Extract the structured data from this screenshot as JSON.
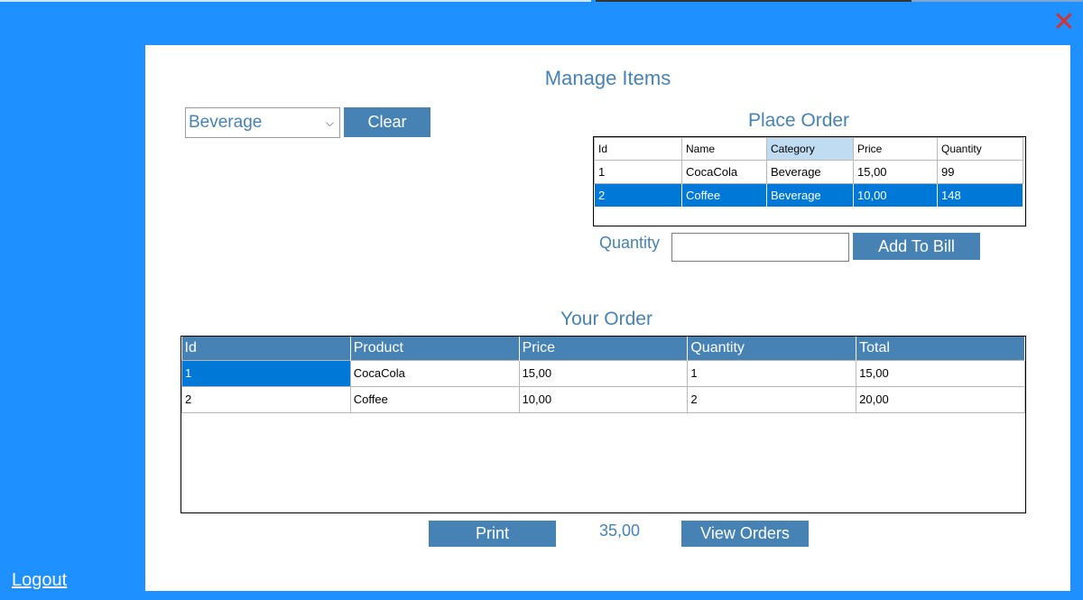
{
  "window": {
    "close_glyph": "✕",
    "logout_label": "Logout"
  },
  "manage": {
    "title": "Manage Items",
    "category_selected": "Beverage",
    "clear_label": "Clear"
  },
  "place_order": {
    "title": "Place Order",
    "columns": [
      "Id",
      "Name",
      "Category",
      "Price",
      "Quantity"
    ],
    "rows": [
      [
        "1",
        "CocaCola",
        "Beverage",
        "15,00",
        "99"
      ],
      [
        "2",
        "Coffee",
        "Beverage",
        "10,00",
        "148"
      ]
    ],
    "quantity_label": "Quantity",
    "quantity_value": "",
    "add_label": "Add To Bill"
  },
  "your_order": {
    "title": "Your Order",
    "columns": [
      "Id",
      "Product",
      "Price",
      "Quantity",
      "Total"
    ],
    "rows": [
      [
        "1",
        "CocaCola",
        "15,00",
        "1",
        "15,00"
      ],
      [
        "2",
        "Coffee",
        "10,00",
        "2",
        "20,00"
      ]
    ],
    "print_label": "Print",
    "total": "35,00",
    "view_orders_label": "View Orders"
  },
  "colors": {
    "background": "#1e90ff",
    "accent": "#4682b4",
    "selection": "#0078d7",
    "close": "#d9302c"
  },
  "icons": {
    "close": "close-icon",
    "dropdown": "chevron-down-icon"
  }
}
